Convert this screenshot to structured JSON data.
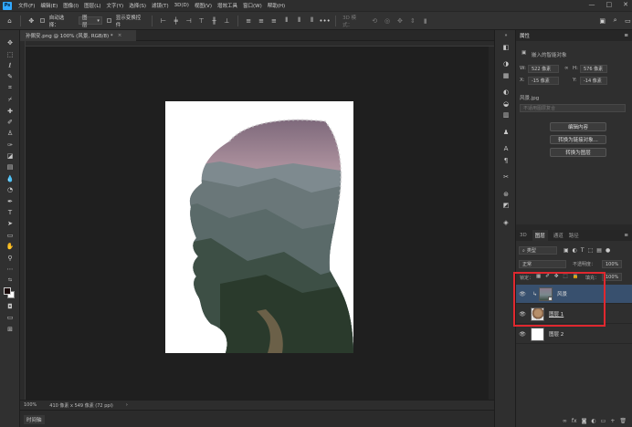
{
  "app": {
    "logo": "Ps"
  },
  "menu": [
    "文件(F)",
    "编辑(E)",
    "图像(I)",
    "图层(L)",
    "文字(Y)",
    "选择(S)",
    "滤镜(T)",
    "3D(D)",
    "视图(V)",
    "增效工具",
    "窗口(W)",
    "帮助(H)"
  ],
  "window_controls": [
    "—",
    "□",
    "✕"
  ],
  "options": {
    "auto_select_label": "自动选择：",
    "auto_select_value": "图层",
    "show_transform_label": "显示变换控件",
    "mode3d_label": "3D 模式：",
    "more": "•••"
  },
  "document_tab": {
    "title": "孙佩安.png @ 100% (风景, RGB/8) *",
    "close": "×"
  },
  "status": {
    "zoom": "100%",
    "size": "410 像素 x 549 像素 (72 ppi)"
  },
  "timeline": {
    "label": "时间轴"
  },
  "properties": {
    "title": "属性",
    "type_label": "嵌入的智能对象",
    "w_label": "W:",
    "w_value": "522 像素",
    "h_label": "H:",
    "h_value": "576 像素",
    "x_label": "X:",
    "x_value": "-15 像素",
    "y_label": "Y:",
    "y_value": "-14 像素",
    "file_label": "风景.jpg",
    "comp_placeholder": "不适用图层复合",
    "buttons": [
      "编辑内容",
      "转换为链接对象...",
      "转换为图层"
    ]
  },
  "layers_panel": {
    "tabs": [
      "3D",
      "图层",
      "通道",
      "路径"
    ],
    "filter_value": "类型",
    "blend_mode": "正常",
    "opacity_label": "不透明度：",
    "opacity_value": "100%",
    "lock_label": "锁定：",
    "fill_label": "填充：",
    "fill_value": "100%",
    "layers": [
      {
        "name": "风景",
        "selected": true
      },
      {
        "name": "图层 1",
        "selected": false
      },
      {
        "name": "图层 2",
        "selected": false
      }
    ],
    "bottom_icons": [
      "∞",
      "fx",
      "◙",
      "◐",
      "▭",
      "+",
      "🗑"
    ]
  },
  "colors": {
    "highlight": "#e0282f",
    "selected_layer": "#38506e",
    "accent": "#31a8ff"
  }
}
